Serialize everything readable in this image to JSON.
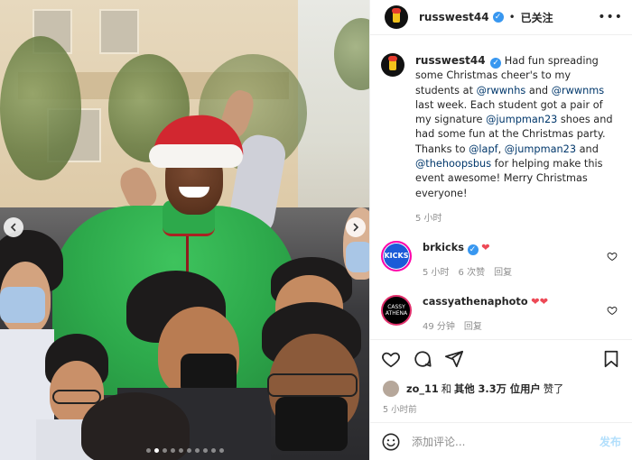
{
  "photo": {
    "description_icons": {
      "prev": "chevron-left-icon",
      "next": "chevron-right-icon"
    },
    "carousel": {
      "total": 10,
      "active_index": 1
    }
  },
  "header": {
    "username": "russwest44",
    "follow_state": "已关注",
    "separator": "•",
    "more_label": "•••"
  },
  "caption": {
    "username": "russwest44",
    "segments": [
      {
        "type": "text",
        "text": "Had fun spreading some Christmas cheer's to my students at "
      },
      {
        "type": "link",
        "text": "@rwwnhs"
      },
      {
        "type": "text",
        "text": " and "
      },
      {
        "type": "link",
        "text": "@rwwnms"
      },
      {
        "type": "text",
        "text": " last week. Each student got a pair of my signature "
      },
      {
        "type": "link",
        "text": "@jumpman23"
      },
      {
        "type": "text",
        "text": " shoes and had some fun at the Christmas party. Thanks to "
      },
      {
        "type": "link",
        "text": "@lapf"
      },
      {
        "type": "text",
        "text": ", "
      },
      {
        "type": "link",
        "text": "@jumpman23"
      },
      {
        "type": "text",
        "text": " and "
      },
      {
        "type": "link",
        "text": "@thehoopsbus"
      },
      {
        "type": "text",
        "text": " for helping make this event awesome! Merry Christmas everyone!"
      }
    ],
    "timestamp": "5 小时"
  },
  "comments": [
    {
      "username": "brkicks",
      "avatar_text": "KICKS",
      "verified": true,
      "text": "❤",
      "time": "5 小时",
      "likes": "6 次赞",
      "reply": "回复"
    },
    {
      "username": "cassyathenaphoto",
      "avatar_text": "CASSY ATHENA",
      "verified": false,
      "text": "❤❤",
      "time": "49 分钟",
      "likes": "",
      "reply": "回复"
    }
  ],
  "likes": {
    "first_user": "zo_11",
    "connector": "和",
    "others_label": "其他 3.3万 位用户",
    "suffix": "赞了"
  },
  "posted": "5 小时前",
  "add_comment": {
    "placeholder": "添加评论...",
    "post_label": "发布"
  },
  "colors": {
    "link": "#00376b",
    "verified": "#3897f0",
    "heart": "#ed4956",
    "muted": "#8e8e8e",
    "post_disabled": "#b2dffc"
  }
}
